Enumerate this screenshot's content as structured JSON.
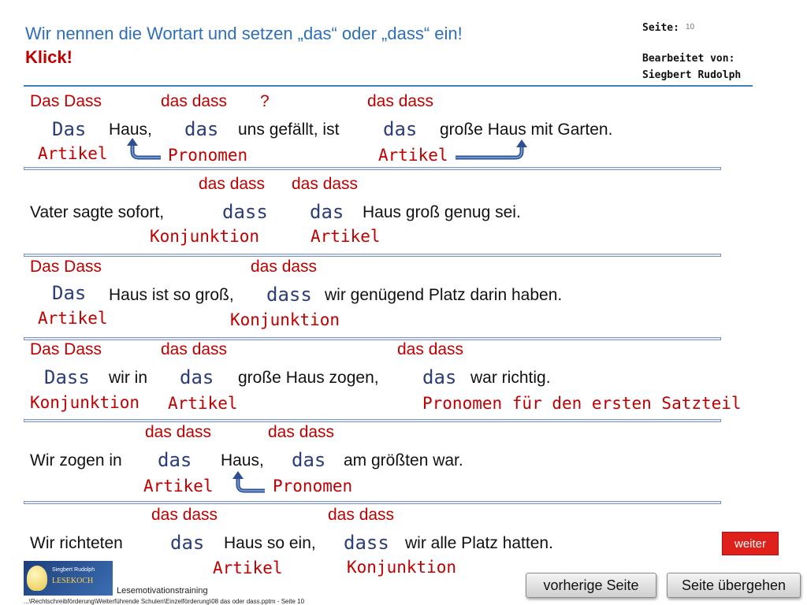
{
  "header": {
    "title": "Wir nennen die Wortart und setzen „das“ oder „dass“ ein!",
    "klick": "Klick!",
    "seite_label": "Seite:",
    "page_number": "10",
    "bearbeitet_label": "Bearbeitet von:",
    "author": "Siegbert Rudolph"
  },
  "symbol": "",
  "rows": [
    {
      "options": [
        "Das Dass",
        "das dass",
        "?",
        "das dass"
      ],
      "sentence": [
        "Haus,",
        "uns gefällt, ist",
        "große Haus mit Garten."
      ],
      "answers": [
        "Das",
        "das",
        "das"
      ],
      "labels": [
        "Artikel",
        "Pronomen",
        "Artikel"
      ]
    },
    {
      "options": [
        "das dass",
        "das dass"
      ],
      "sentence": [
        "Vater sagte sofort,",
        "Haus groß genug sei."
      ],
      "answers": [
        "dass",
        "das"
      ],
      "labels": [
        "Konjunktion",
        "Artikel"
      ]
    },
    {
      "options": [
        "Das Dass",
        "das dass"
      ],
      "sentence": [
        "Haus ist so groß,",
        "wir genügend Platz darin haben."
      ],
      "answers": [
        "Das",
        "dass"
      ],
      "labels": [
        "Artikel",
        "Konjunktion"
      ]
    },
    {
      "options": [
        "Das Dass",
        "das dass",
        "das dass"
      ],
      "sentence": [
        "wir in",
        "große Haus zogen,",
        "war richtig."
      ],
      "answers": [
        "Dass",
        "das",
        "das"
      ],
      "labels": [
        "Konjunktion",
        "Artikel",
        "Pronomen für den ersten Satzteil"
      ]
    },
    {
      "options": [
        "das dass",
        "das dass"
      ],
      "sentence": [
        "Wir zogen in",
        "Haus,",
        "am größten war."
      ],
      "answers": [
        "das",
        "das"
      ],
      "labels": [
        "Artikel",
        "Pronomen"
      ]
    },
    {
      "options": [
        "das dass",
        "das dass"
      ],
      "sentence": [
        "Wir richteten",
        "Haus so ein,",
        "wir alle Platz hatten."
      ],
      "answers": [
        "das",
        "dass"
      ],
      "labels": [
        "Artikel",
        "Konjunktion"
      ]
    }
  ],
  "buttons": {
    "weiter": "weiter",
    "previous": "vorherige Seite",
    "skip": "Seite übergehen"
  },
  "footer": {
    "logo_line1": "Siegbert Rudolph",
    "logo_line2": "LESEKOCH",
    "course": "Lesemotivationstraining",
    "path": "...\\Rechtschreibförderung\\Weiterführende Schulen\\Einzelförderung\\08 das oder dass.pptm - Seite 10"
  },
  "colors": {
    "title": "#2e6fb6",
    "option_red": "#c00000",
    "answer_blue": "#2c3e7a",
    "weiter_button": "#e0201b"
  }
}
